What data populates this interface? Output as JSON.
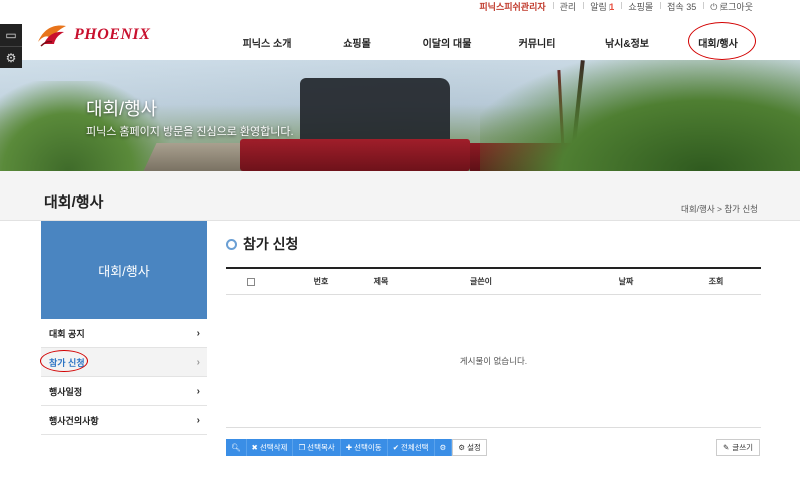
{
  "util_bar": {
    "admin_name": "피닉스피쉬관리자",
    "manage": "관리",
    "alarm_label": "알림",
    "alarm_count": "1",
    "mall": "쇼핑몰",
    "visitors": "접속 35",
    "logout": "로그아웃"
  },
  "logo": {
    "text": "PHOENIX"
  },
  "gnb": [
    {
      "label": "피닉스 소개"
    },
    {
      "label": "쇼핑몰"
    },
    {
      "label": "이달의 대물"
    },
    {
      "label": "커뮤니티"
    },
    {
      "label": "낚시&정보"
    },
    {
      "label": "대회/행사"
    }
  ],
  "hero": {
    "title": "대회/행사",
    "subtitle": "피닉스 홈페이지 방문을 진심으로 환영합니다."
  },
  "page": {
    "title": "대회/행사",
    "breadcrumb": "대회/행사 > 참가 신청"
  },
  "sidebar": {
    "header": "대회/행사",
    "items": [
      {
        "label": "대회 공지",
        "active": false
      },
      {
        "label": "참가 신청",
        "active": true
      },
      {
        "label": "행사일정",
        "active": false
      },
      {
        "label": "행사건의사항",
        "active": false
      }
    ]
  },
  "main": {
    "title": "참가 신청",
    "columns": [
      "번호",
      "제목",
      "글쓴이",
      "날짜",
      "조회"
    ],
    "empty_message": "게시물이 없습니다."
  },
  "toolbar": {
    "delete": "선택삭제",
    "copy": "선택복사",
    "move": "선택이동",
    "edit": "전체선택",
    "settings": "설정",
    "write": "글쓰기"
  },
  "colors": {
    "accent": "#4a85c1",
    "button": "#3a8ee6",
    "brand": "#c8102e",
    "annotation": "#d20000"
  }
}
